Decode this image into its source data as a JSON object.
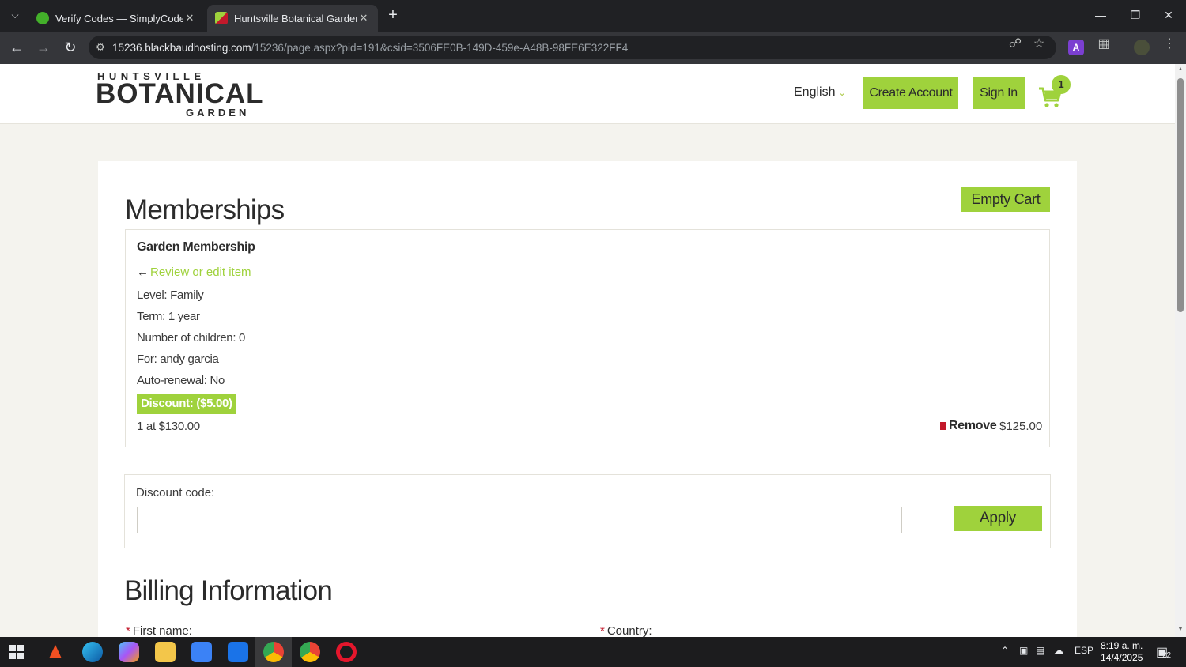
{
  "browser": {
    "tabs": [
      {
        "title": "Verify Codes — SimplyCodes",
        "active": false,
        "favicon_color": "#43b02a"
      },
      {
        "title": "Huntsville Botanical Garden",
        "active": true,
        "favicon_color": "#9fd23c"
      }
    ],
    "url_host": "15236.blackbaudhosting.com",
    "url_path": "/15236/page.aspx?pid=191&csid=3506FE0B-149D-459e-A48B-98FE6E322FF4"
  },
  "site": {
    "logo": {
      "line1": "HUNTSVILLE",
      "line2": "BOTANICAL",
      "line3": "GARDEN"
    },
    "language": "English",
    "create_account": "Create Account",
    "sign_in": "Sign In",
    "cart_count": "1",
    "accent_color": "#9fd23c"
  },
  "cart": {
    "heading": "Memberships",
    "empty_cart": "Empty Cart",
    "item": {
      "title": "Garden Membership",
      "review_link": "Review or edit item",
      "level": "Level: Family",
      "term": "Term: 1 year",
      "children": "Number of children: 0",
      "for": "For: andy garcia",
      "auto_renewal": "Auto-renewal: No",
      "discount": "Discount: ($5.00)",
      "quantity": "1 at $130.00",
      "remove": "Remove",
      "price": "$125.00"
    },
    "discount_code": {
      "label": "Discount code:",
      "value": "",
      "apply": "Apply"
    }
  },
  "billing": {
    "heading": "Billing Information",
    "first_name_label": "First name:",
    "country_label": "Country:",
    "required_marker": "*"
  },
  "taskbar": {
    "language": "ESP",
    "time": "8:19 a. m.",
    "date": "14/4/2025",
    "notifications": "22"
  }
}
